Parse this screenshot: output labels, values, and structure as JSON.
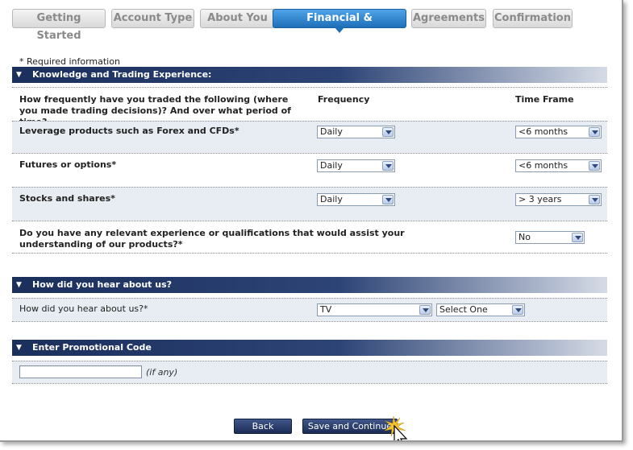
{
  "tabs": [
    {
      "label": "Getting Started",
      "active": false
    },
    {
      "label": "Account Type",
      "active": false
    },
    {
      "label": "About You",
      "active": false
    },
    {
      "label": "Financial & Experience",
      "active": true
    },
    {
      "label": "Agreements",
      "active": false
    },
    {
      "label": "Confirmation",
      "active": false
    }
  ],
  "required_note": "* Required information",
  "knowledge": {
    "header": "Knowledge and Trading Experience:",
    "question": "How frequently have you traded the following (where you made trading decisions)? And over what period of time?",
    "frequency_header": "Frequency",
    "timeframe_header": "Time Frame",
    "rows": [
      {
        "label": "Leverage products such as Forex and CFDs*",
        "frequency": "Daily",
        "timeframe": "<6 months"
      },
      {
        "label": "Futures or options*",
        "frequency": "Daily",
        "timeframe": "<6 months"
      },
      {
        "label": "Stocks and shares*",
        "frequency": "Daily",
        "timeframe": "> 3 years"
      }
    ],
    "qualifications_label": "Do you have any relevant experience or qualifications that would assist your understanding of our products?*",
    "qualifications_value": "No"
  },
  "referral": {
    "header": "How did you hear about us?",
    "label": "How did you hear about us?*",
    "source_value": "TV",
    "detail_value": "Select One"
  },
  "promo": {
    "header": "Enter Promotional Code",
    "value": "",
    "hint": "(if any)"
  },
  "buttons": {
    "back": "Back",
    "save_continue": "Save and Continue"
  },
  "colors": {
    "active_tab": "#1e6fb8",
    "section_header": "#1b2f5c",
    "button": "#1b2c55"
  }
}
